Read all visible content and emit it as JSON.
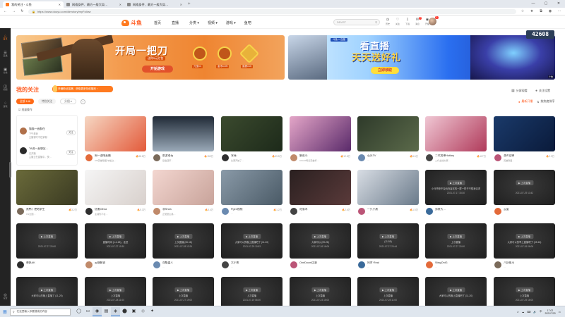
{
  "browser": {
    "tabs": [
      {
        "label": "我的关注 - 斗鱼",
        "color": "#ff7a1f",
        "active": true
      },
      {
        "label": "网络身件、最方一般大局…",
        "color": "#888",
        "active": false
      },
      {
        "label": "网络身件、最方一般大局…",
        "color": "#888",
        "active": false
      }
    ],
    "new_tab": "+",
    "window_controls": [
      "—",
      "▢",
      "✕"
    ],
    "url": "https://www.douyu.com/directory/myFollow",
    "nav_icons": [
      "←",
      "→",
      "↻"
    ],
    "right_icons": [
      "☆",
      "★",
      "⧉",
      "◉",
      "⋯"
    ]
  },
  "rail": {
    "items": [
      {
        "icon": "⌂",
        "label": "首页",
        "selected": true,
        "icon_name": "home-icon"
      },
      {
        "icon": "☰",
        "label": "直播",
        "selected": false,
        "icon_name": "live-icon"
      },
      {
        "icon": "▣",
        "label": "分类",
        "selected": false,
        "icon_name": "category-icon"
      },
      {
        "icon": "◫",
        "label": "视频",
        "selected": false,
        "icon_name": "video-icon"
      },
      {
        "icon": "♢",
        "label": "游戏",
        "selected": false,
        "icon_name": "game-icon"
      },
      {
        "icon": "◎",
        "label": "设置",
        "selected": false,
        "icon_name": "settings-icon"
      }
    ]
  },
  "header": {
    "logo_text": "斗鱼",
    "nav": [
      "首页",
      "直播",
      "分类 ▾",
      "视频 ▾",
      "游戏 ▾",
      "鱼吧"
    ],
    "search_placeholder": "DEVIST",
    "icons": [
      {
        "icon": "◷",
        "label": "历史",
        "name": "history-icon",
        "badge": ""
      },
      {
        "icon": "♡",
        "label": "关注",
        "name": "follow-icon",
        "badge": ""
      },
      {
        "icon": "⇩",
        "label": "下载",
        "name": "download-icon",
        "badge": ""
      },
      {
        "icon": "✉",
        "label": "消息",
        "name": "message-icon",
        "badge": "2"
      },
      {
        "icon": "◉",
        "label": "开播",
        "name": "broadcast-icon",
        "badge": ""
      }
    ],
    "avatar_badge": "1"
  },
  "banners": {
    "left": {
      "headline": "开局一把刀",
      "sub": "送你5元红包",
      "button": "开始游戏",
      "coins": [
        "元宝x1",
        "金币x1W",
        "道具x10"
      ]
    },
    "right": {
      "line1": "看直播",
      "line2": "天天送好礼",
      "button": "立即领取",
      "brand": "斗鱼 × 百度",
      "ad": "广告",
      "live": "● LIVE"
    },
    "side_counter": "42608"
  },
  "follow": {
    "title": "我的关注",
    "promo": "开通粉丝铭牌，获取更多特权福利 ›",
    "links": [
      {
        "icon": "▦",
        "label": "分屏观看"
      },
      {
        "icon": "●",
        "label": "关注设置"
      }
    ],
    "filters": [
      {
        "label": "全部 146",
        "on": true
      },
      {
        "label": "特别关注",
        "on": false
      }
    ],
    "dropdown": "分组 ▾",
    "add": "+",
    "sort": [
      {
        "icon": "●",
        "label": "最新开播"
      },
      {
        "icon": "⇅",
        "label": "按热度排序"
      }
    ],
    "batch": "☑ 批量操作",
    "list": [
      {
        "name": "猫猫一直都在",
        "status": "下午看我",
        "desc": "主播暂时不在家哦~",
        "btn": "关注",
        "color": "#b0704a"
      },
      {
        "name": "TA说一直想念…",
        "status": "已开播",
        "desc": "主播正在直播中，快…",
        "btn": "关注",
        "color": "#2a2a2a"
      }
    ]
  },
  "grid": {
    "rows": [
      [
        {
          "name": "周一酒吧直播",
          "sub": "CM英雄联盟·峡谷之…",
          "heat": "🔥88.8万",
          "live": true
        },
        {
          "name": "前游老玩",
          "sub": "复盘冠军…",
          "heat": "🔥159万",
          "live": true
        },
        {
          "name": "冰瑶·",
          "sub": "比赛开始了…",
          "heat": "🔥59.5万",
          "live": true
        },
        {
          "name": "解说小",
          "sub": "CSGO每日英雄杯…",
          "heat": "🔥12.8万",
          "live": true
        },
        {
          "name": "石头TV",
          "sub": "…",
          "heat": "🔥5.6万",
          "live": true
        },
        {
          "name": "二代男神Hotkey",
          "sub": "二代主播大赛…",
          "heat": "🔥127万",
          "live": true
        },
        {
          "name": "洛炎战神",
          "sub": "英雄联盟…",
          "heat": "🔥9.3万",
          "live": true
        }
      ],
      [
        {
          "name": "黑鸭丨绝地求生",
          "sub": "CS全国…",
          "heat": "🔥3.2万",
          "live": true
        },
        {
          "name": "优雅Olivia",
          "sub": "主播暂不在…",
          "heat": "🔥5.3万",
          "live": true
        },
        {
          "name": "菲Shea",
          "sub": "正能量主播…",
          "heat": "🔥5.4万",
          "live": true
        },
        {
          "name": "Pgen视频",
          "sub": "…",
          "heat": "🔥1.2万",
          "live": true
        },
        {
          "name": "花落木",
          "sub": "…",
          "heat": "🔥2.6万",
          "live": true
        },
        {
          "name": "一只小黑",
          "sub": "…",
          "heat": "🔥1.5万",
          "live": true
        },
        {
          "name": "男装大…",
          "sub": "",
          "heat": "",
          "live": false,
          "title": "小马哥来不及玩你喜欢的一群一样子不想我请求",
          "time": "2021-07-17 15:30"
        },
        {
          "name": "云爱",
          "sub": "",
          "heat": "",
          "live": false,
          "title": "",
          "time": "2021-07-29 13:42"
        }
      ],
      [
        {
          "name": "晓妖AK",
          "sub": "…",
          "heat": "",
          "live": false,
          "title": "",
          "time": "2021-07-27 20:00"
        },
        {
          "name": "云端解说",
          "sub": "…",
          "heat": "",
          "live": false,
          "title": "直播时间 (1-4-18)，走进",
          "time": "2021-07-27 19:30"
        },
        {
          "name": "花魁嘉人",
          "sub": "…",
          "heat": "",
          "live": false,
          "title": "上次直播 (06-18)",
          "time": "2021-07-28 13:26"
        },
        {
          "name": "大小熊",
          "sub": "…",
          "heat": "",
          "live": false,
          "title": "大家可以的晚上直播吧了 (11-20)",
          "time": "2021-07-29 10:53"
        },
        {
          "name": "OneDoom比赛",
          "sub": "…",
          "heat": "",
          "live": false,
          "title": "大家可以 (09-28)",
          "time": "2021-07-26 16:06"
        },
        {
          "name": "阿罗·Real",
          "sub": "…",
          "heat": "",
          "live": false,
          "title": "(11-55)",
          "time": "2021-07-27 20:44"
        },
        {
          "name": "StingOnlG",
          "sub": "…",
          "heat": "",
          "live": false,
          "title": "上次直播",
          "time": "2021-07-27 20:00"
        },
        {
          "name": "八卦贩马",
          "sub": "…",
          "heat": "",
          "live": false,
          "title": "大家可以的早上直播吧了 (05-18)",
          "time": "2021-07-26 06:06"
        }
      ],
      [
        {
          "name": "",
          "sub": "",
          "heat": "",
          "live": false,
          "title": "大家可以的晚上直播了 (11-20)",
          "time": ""
        },
        {
          "name": "",
          "sub": "",
          "heat": "",
          "live": false,
          "title": "上次直播",
          "time": "2021-07-28 11:00"
        },
        {
          "name": "",
          "sub": "",
          "heat": "",
          "live": false,
          "title": "上次直播",
          "time": "2021-07-27 19:00"
        },
        {
          "name": "",
          "sub": "",
          "heat": "",
          "live": false,
          "title": "上次直播",
          "time": "2021-07-19 06:00"
        },
        {
          "name": "",
          "sub": "",
          "heat": "",
          "live": false,
          "title": "上次直播",
          "time": "2021-07-23 15:00"
        },
        {
          "name": "",
          "sub": "",
          "heat": "",
          "live": false,
          "title": "上次直播",
          "time": "2021-07-28 11:00"
        },
        {
          "name": "",
          "sub": "",
          "heat": "",
          "live": false,
          "title": "大家可以的晚上直播吧了 (11-20)",
          "time": ""
        },
        {
          "name": "",
          "sub": "",
          "heat": "",
          "live": false,
          "title": "上次直播",
          "time": "2021-07-29 16:00"
        }
      ]
    ],
    "offline_tag": "▶ 上次直播"
  },
  "taskbar": {
    "start": "⊞",
    "search": "在这里输入你要搜索的内容",
    "apps": [
      "◯",
      "▭",
      "◉",
      "▤",
      "◈",
      "⬤",
      "▣",
      "◇",
      "✦"
    ],
    "right": [
      "∧",
      "☁",
      "⌨",
      "🔊",
      "中"
    ],
    "time": "17:02",
    "date": "2021/7/29"
  }
}
